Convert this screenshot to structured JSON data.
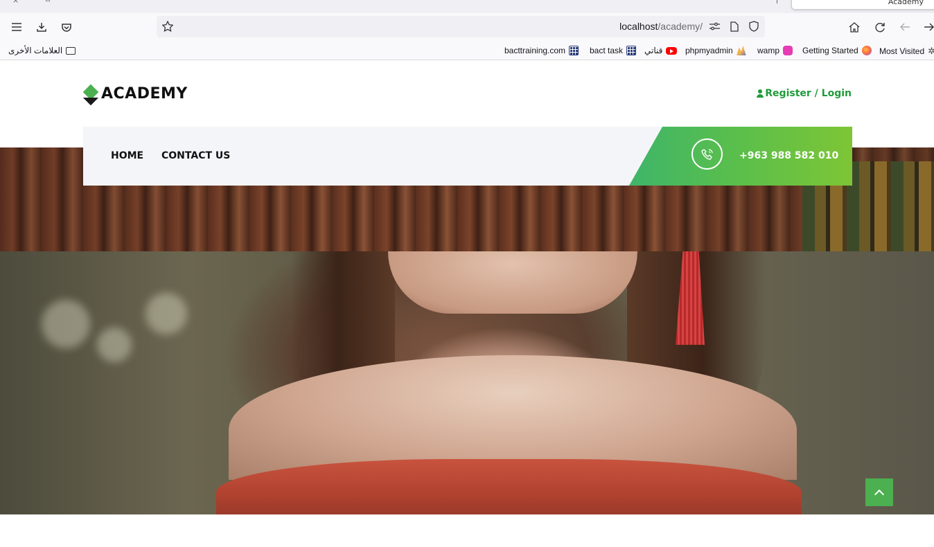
{
  "browser": {
    "active_tab_title": "Academy",
    "url_host": "localhost",
    "url_path": "/academy/",
    "bookmarks": [
      {
        "label": "Most Visited",
        "icon": "gear-icon"
      },
      {
        "label": "Getting Started",
        "icon": "firefox-icon"
      },
      {
        "label": "wamp",
        "icon": "wamp-icon"
      },
      {
        "label": "phpmyadmin",
        "icon": "phpmyadmin-icon"
      },
      {
        "label": "قناتي",
        "icon": "youtube-icon"
      },
      {
        "label": "bact task",
        "icon": "grid-icon"
      },
      {
        "label": "bacttraining.com",
        "icon": "grid-icon"
      }
    ],
    "other_bookmarks_label": "العلامات الأخرى"
  },
  "site": {
    "logo_text": "ACADEMY",
    "register_label": "Register / Login",
    "nav": {
      "items": [
        "HOME",
        "CONTACT US"
      ],
      "phone": "+963 988 582 010"
    },
    "colors": {
      "accent": "#4caf50",
      "accent_dark": "#1f9b3a",
      "nav_bg": "#f4f5f9"
    }
  }
}
